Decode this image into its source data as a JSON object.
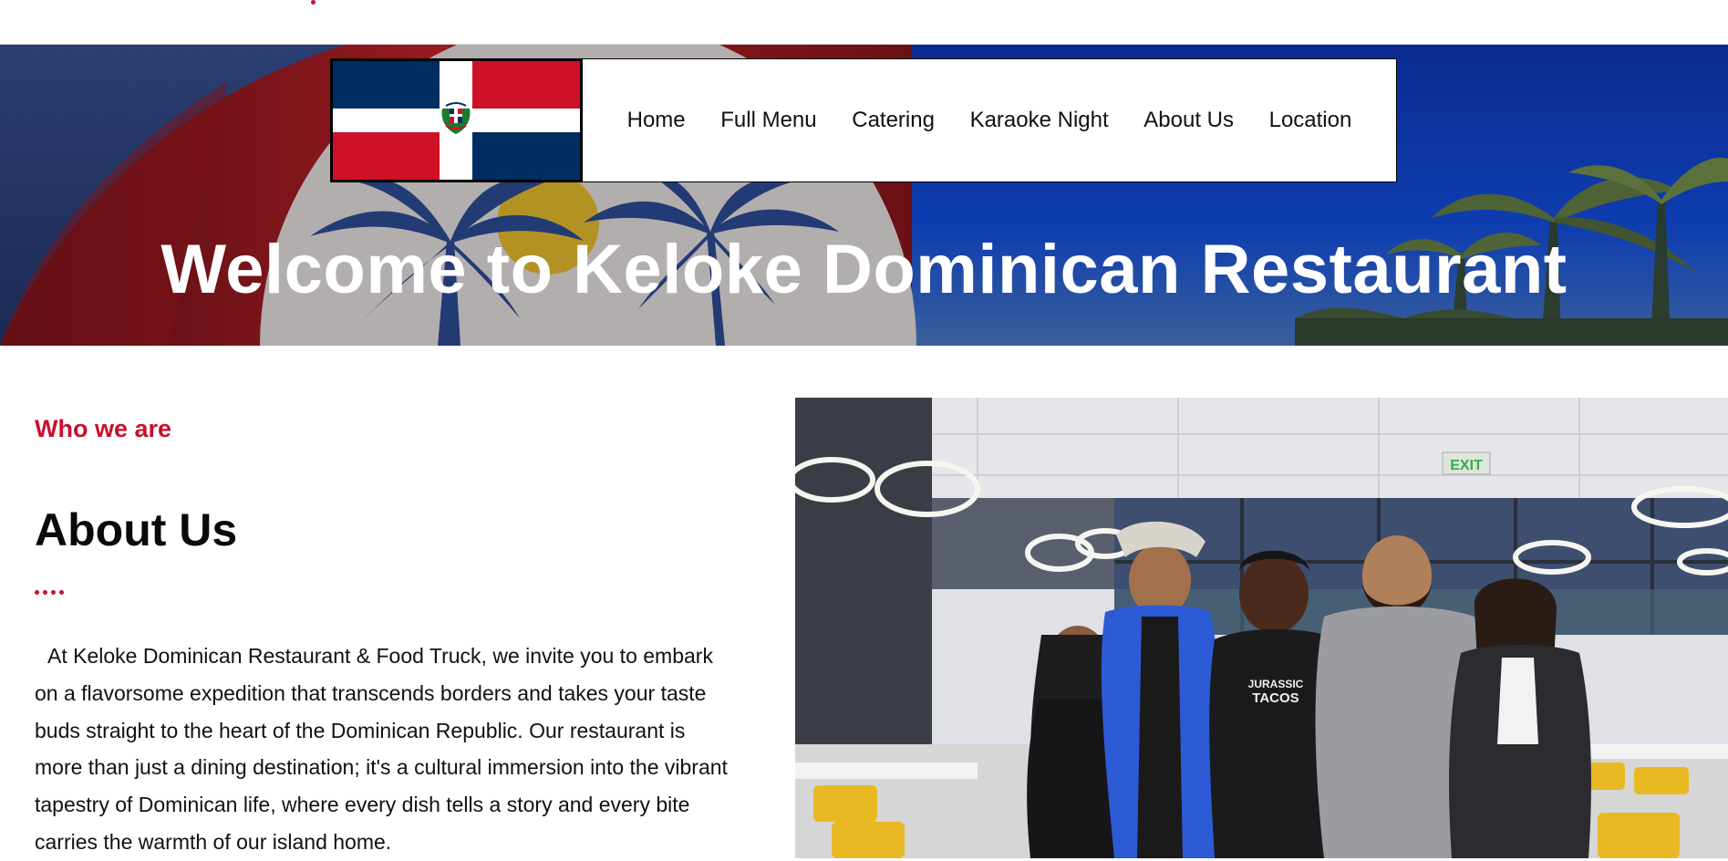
{
  "top_strip": {},
  "nav": {
    "items": [
      {
        "label": "Home"
      },
      {
        "label": "Full Menu"
      },
      {
        "label": "Catering"
      },
      {
        "label": "Karaoke Night"
      },
      {
        "label": "About Us"
      },
      {
        "label": "Location"
      }
    ]
  },
  "hero": {
    "title": "Welcome to Keloke Dominican Restaurant"
  },
  "about": {
    "eyebrow": "Who we are",
    "title": "About Us",
    "body": "At Keloke Dominican Restaurant & Food Truck, we invite you to embark on a flavorsome expedition that transcends borders and takes your taste buds straight to the heart of the Dominican Republic. Our restaurant is more than just a dining destination; it's a cultural immersion into the vibrant tapestry of Dominican life, where every dish tells a story and every bite carries the warmth of our island home."
  },
  "photo": {
    "exit_sign": "EXIT",
    "shirt_text_1": "JURASSIC",
    "shirt_text_2": "TACOS"
  },
  "colors": {
    "accent_red": "#c8102e",
    "flag_blue": "#002d62",
    "flag_red": "#ce1126",
    "hero_blue": "#0c3aa8"
  }
}
